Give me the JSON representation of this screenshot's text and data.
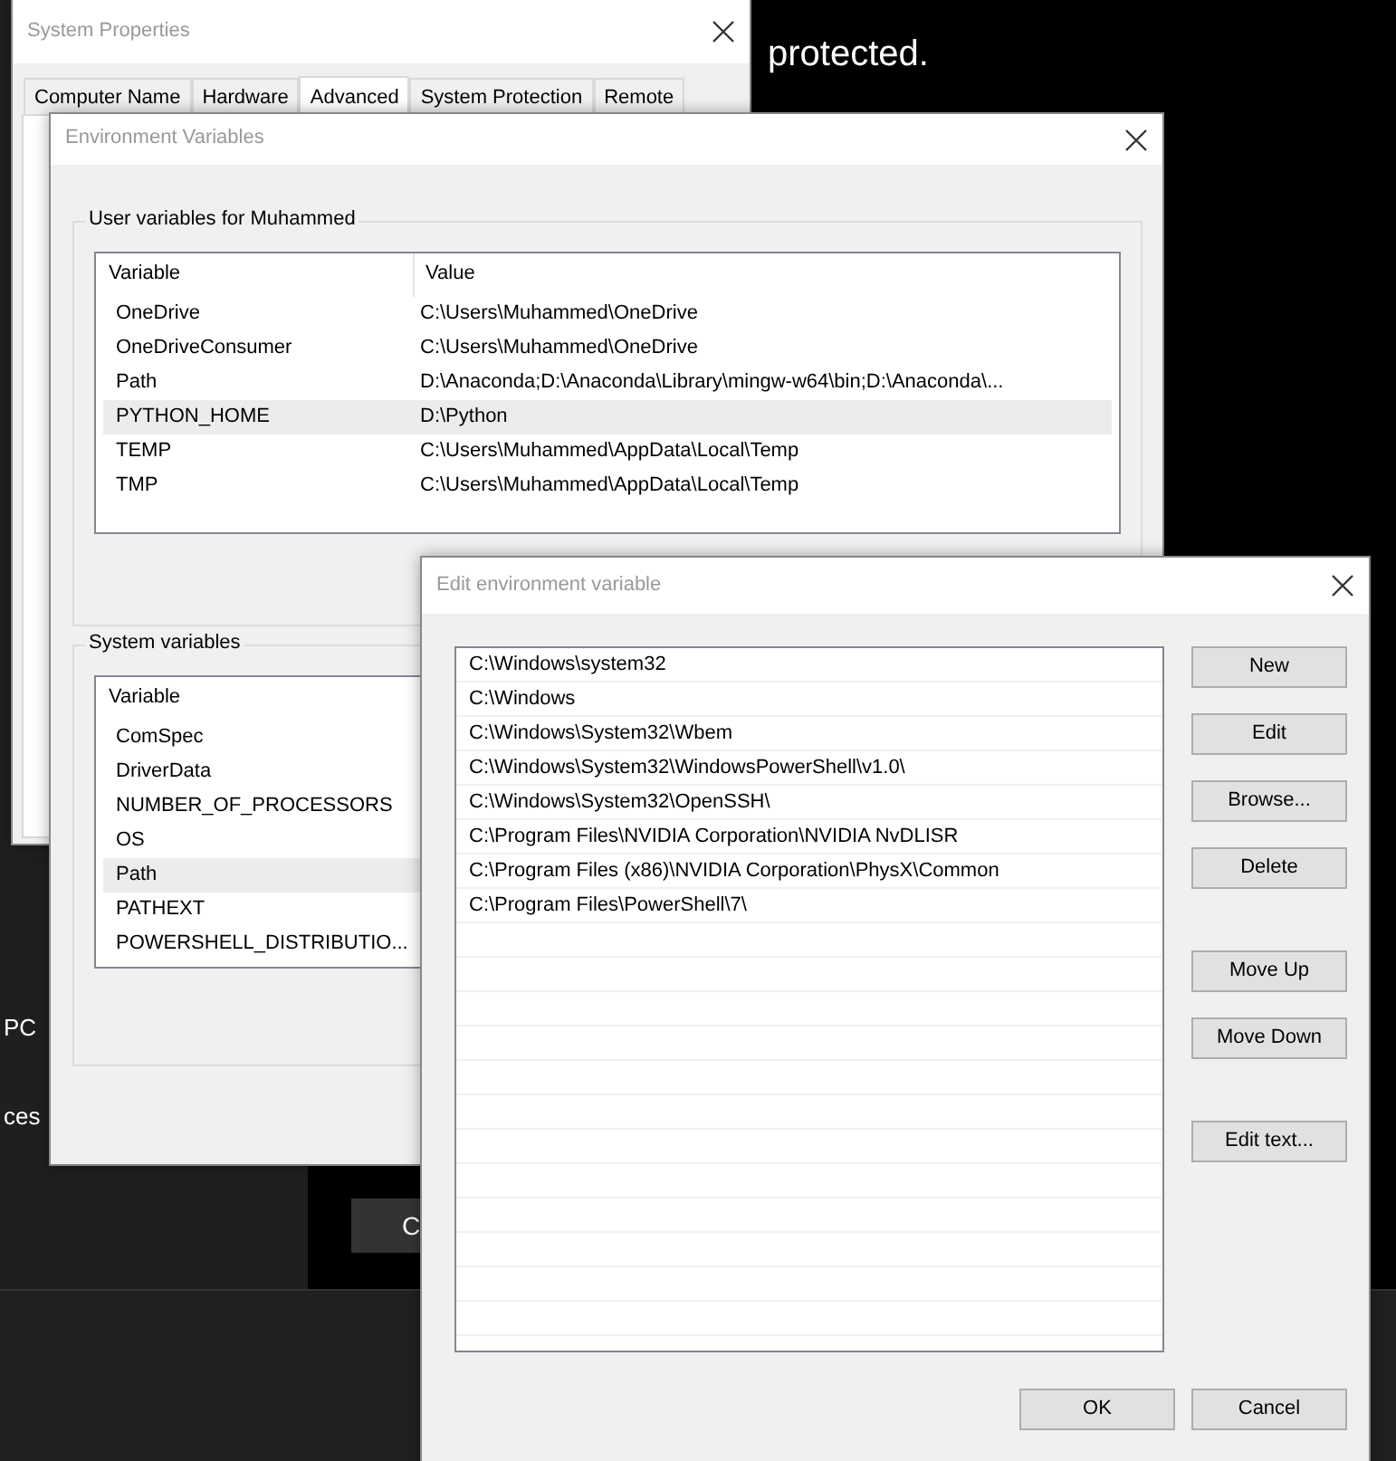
{
  "background": {
    "heading": "protected.",
    "side_texts": [
      "PC",
      "ces"
    ],
    "button": "C"
  },
  "system_properties": {
    "title": "System Properties",
    "tabs": [
      {
        "label": "Computer Name",
        "selected": false
      },
      {
        "label": "Hardware",
        "selected": false
      },
      {
        "label": "Advanced",
        "selected": true
      },
      {
        "label": "System Protection",
        "selected": false
      },
      {
        "label": "Remote",
        "selected": false
      }
    ]
  },
  "environment_variables": {
    "title": "Environment Variables",
    "user_variables": {
      "label": "User variables for Muhammed",
      "columns": [
        "Variable",
        "Value"
      ],
      "rows": [
        {
          "variable": "OneDrive",
          "value": "C:\\Users\\Muhammed\\OneDrive",
          "selected": false
        },
        {
          "variable": "OneDriveConsumer",
          "value": "C:\\Users\\Muhammed\\OneDrive",
          "selected": false
        },
        {
          "variable": "Path",
          "value": "D:\\Anaconda;D:\\Anaconda\\Library\\mingw-w64\\bin;D:\\Anaconda\\...",
          "selected": false
        },
        {
          "variable": "PYTHON_HOME",
          "value": "D:\\Python",
          "selected": true
        },
        {
          "variable": "TEMP",
          "value": "C:\\Users\\Muhammed\\AppData\\Local\\Temp",
          "selected": false
        },
        {
          "variable": "TMP",
          "value": "C:\\Users\\Muhammed\\AppData\\Local\\Temp",
          "selected": false
        }
      ]
    },
    "system_variables": {
      "label": "System variables",
      "columns": [
        "Variable"
      ],
      "rows": [
        {
          "variable": "ComSpec",
          "selected": false
        },
        {
          "variable": "DriverData",
          "selected": false
        },
        {
          "variable": "NUMBER_OF_PROCESSORS",
          "selected": false
        },
        {
          "variable": "OS",
          "selected": false
        },
        {
          "variable": "Path",
          "selected": true
        },
        {
          "variable": "PATHEXT",
          "selected": false
        },
        {
          "variable": "POWERSHELL_DISTRIBUTIO...",
          "selected": false
        }
      ]
    }
  },
  "edit_variable": {
    "title": "Edit environment variable",
    "entries": [
      "C:\\Windows\\system32",
      "C:\\Windows",
      "C:\\Windows\\System32\\Wbem",
      "C:\\Windows\\System32\\WindowsPowerShell\\v1.0\\",
      "C:\\Windows\\System32\\OpenSSH\\",
      "C:\\Program Files\\NVIDIA Corporation\\NVIDIA NvDLISR",
      "C:\\Program Files (x86)\\NVIDIA Corporation\\PhysX\\Common",
      "C:\\Program Files\\PowerShell\\7\\"
    ],
    "button_groups": [
      [
        "New",
        "Edit",
        "Browse...",
        "Delete"
      ],
      [
        "Move Up",
        "Move Down"
      ],
      [
        "Edit text..."
      ]
    ],
    "footer_buttons": [
      "OK",
      "Cancel"
    ]
  }
}
